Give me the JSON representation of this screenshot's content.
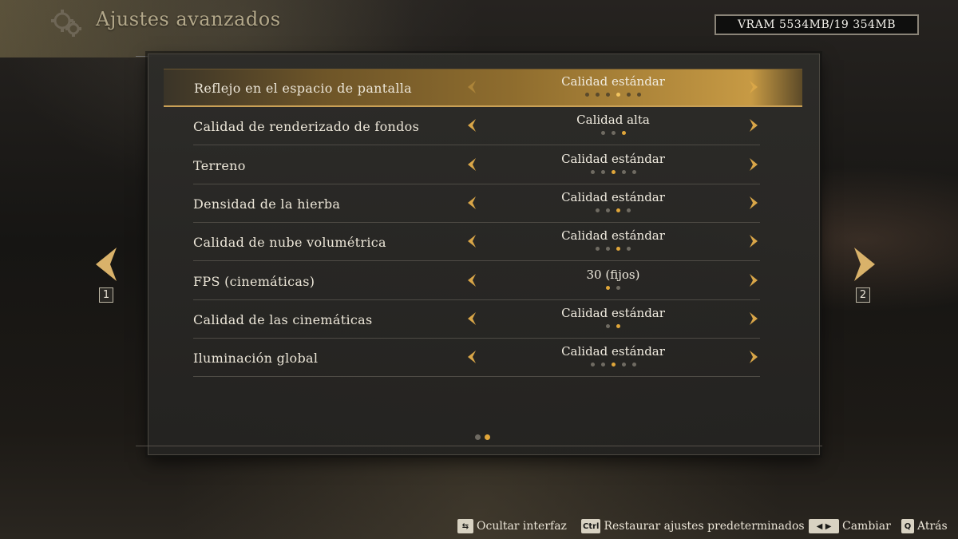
{
  "header": {
    "title": "Ajustes avanzados",
    "icon": "gear-cluster-icon"
  },
  "vram": "VRAM 5534MB/19 354MB",
  "settings": [
    {
      "label": "Reflejo en el espacio de pantalla",
      "value": "Calidad estándar",
      "levels": 6,
      "selected_level": 4,
      "selected": true
    },
    {
      "label": "Calidad de renderizado de fondos",
      "value": "Calidad alta",
      "levels": 3,
      "selected_level": 3,
      "selected": false
    },
    {
      "label": "Terreno",
      "value": "Calidad estándar",
      "levels": 5,
      "selected_level": 3,
      "selected": false
    },
    {
      "label": "Densidad de la hierba",
      "value": "Calidad estándar",
      "levels": 4,
      "selected_level": 3,
      "selected": false
    },
    {
      "label": "Calidad de nube volumétrica",
      "value": "Calidad estándar",
      "levels": 4,
      "selected_level": 3,
      "selected": false
    },
    {
      "label": "FPS (cinemáticas)",
      "value": "30 (fijos)",
      "levels": 2,
      "selected_level": 1,
      "selected": false
    },
    {
      "label": "Calidad de las cinemáticas",
      "value": "Calidad estándar",
      "levels": 2,
      "selected_level": 2,
      "selected": false
    },
    {
      "label": "Iluminación global",
      "value": "Calidad estándar",
      "levels": 5,
      "selected_level": 3,
      "selected": false
    }
  ],
  "pagination": {
    "pages": 2,
    "current": 2,
    "prev_key": "1",
    "next_key": "2"
  },
  "footer": [
    {
      "key": "⇆",
      "label": "Ocultar interfaz"
    },
    {
      "key": "Ctrl",
      "label": "Restaurar ajustes predeterminados"
    },
    {
      "key": "◀ ▶",
      "label": "Cambiar"
    },
    {
      "key": "Q",
      "label": "Atrás"
    }
  ],
  "colors": {
    "accent": "#e0a63a",
    "selected_row": "#8f6d2e",
    "text": "#ece6d8"
  }
}
